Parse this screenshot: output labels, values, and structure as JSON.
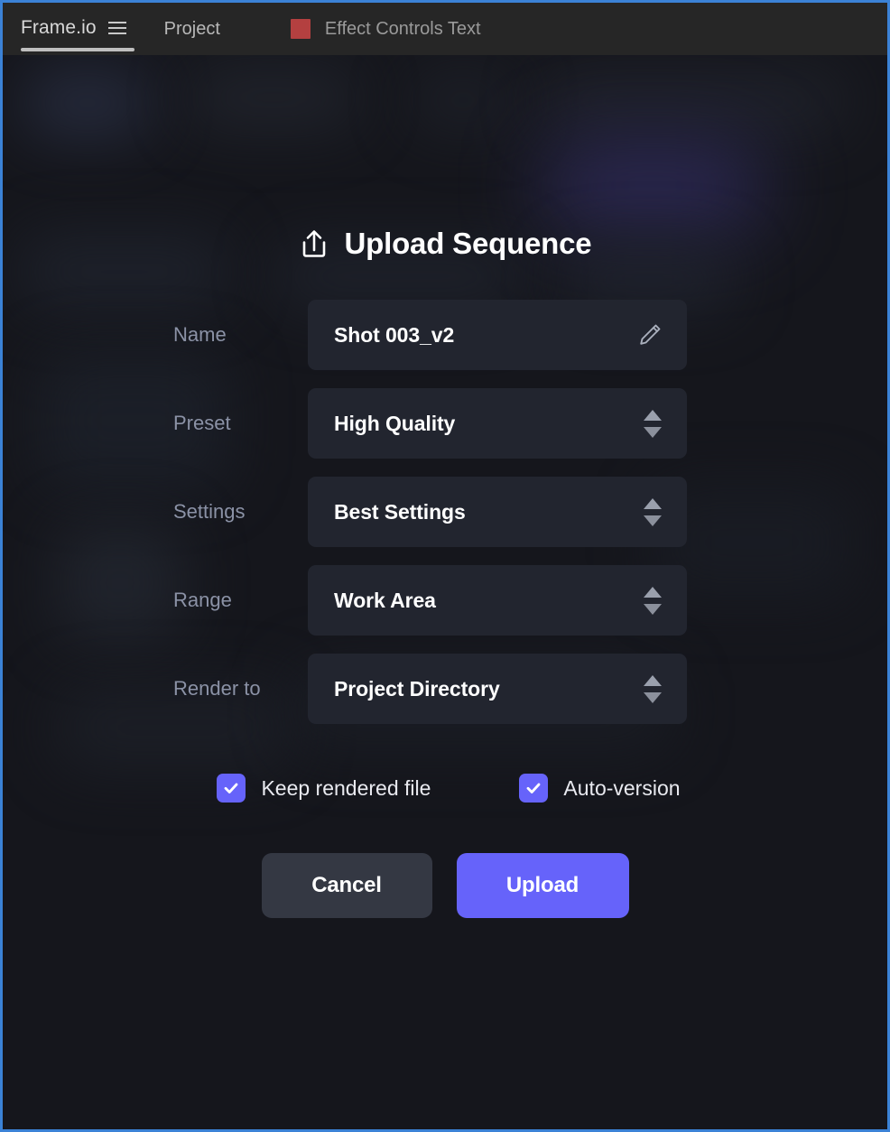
{
  "topbar": {
    "brand": "Frame.io",
    "menu_icon": "hamburger-icon",
    "project_label": "Project",
    "document_swatch_color": "#b44040",
    "document_label": "Effect Controls Text"
  },
  "dialog": {
    "title": "Upload Sequence",
    "title_icon": "upload-icon",
    "fields": [
      {
        "label": "Name",
        "value": "Shot 003_v2",
        "type": "text",
        "trailing_icon": "pencil-icon"
      },
      {
        "label": "Preset",
        "value": "High Quality",
        "type": "stepper",
        "trailing_icon": "stepper-arrows-icon"
      },
      {
        "label": "Settings",
        "value": "Best Settings",
        "type": "stepper",
        "trailing_icon": "stepper-arrows-icon"
      },
      {
        "label": "Range",
        "value": "Work Area",
        "type": "stepper",
        "trailing_icon": "stepper-arrows-icon"
      },
      {
        "label": "Render to",
        "value": "Project Directory",
        "type": "stepper",
        "trailing_icon": "stepper-arrows-icon"
      }
    ],
    "checkboxes": [
      {
        "label": "Keep rendered file",
        "checked": true
      },
      {
        "label": "Auto-version",
        "checked": true
      }
    ],
    "buttons": {
      "cancel": "Cancel",
      "upload": "Upload"
    }
  },
  "colors": {
    "accent": "#6663fa",
    "page_background": "#15161c",
    "field_background": "#22252f",
    "topbar_background": "#262626",
    "window_border": "#3b82d6",
    "label_text": "#8b92a6"
  }
}
